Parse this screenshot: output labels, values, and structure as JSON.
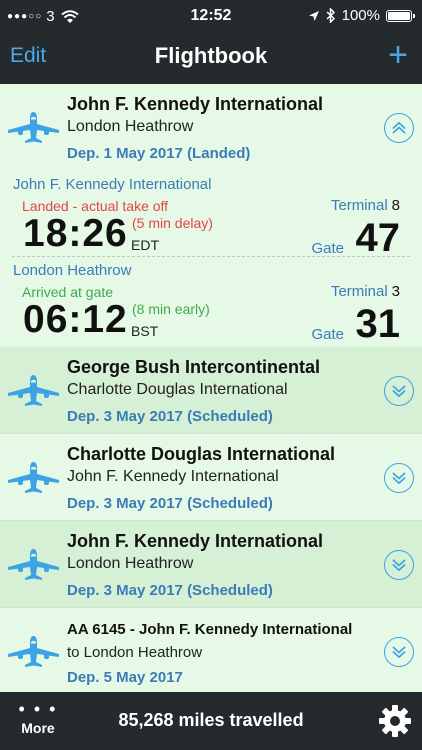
{
  "status_bar": {
    "signal_dots": "●●●○○",
    "carrier": "3",
    "time": "12:52",
    "battery": "100%"
  },
  "nav": {
    "edit_label": "Edit",
    "title": "Flightbook",
    "add_label": "+"
  },
  "expanded_flight": {
    "from": "John F. Kennedy International",
    "to": "London Heathrow",
    "departure": "Dep. 1 May 2017 (Landed)",
    "departure_leg": {
      "airport": "John F. Kennedy International",
      "status": "Landed - actual take off",
      "delay": "(5 min delay)",
      "time": "18:26",
      "timezone": "EDT",
      "terminal_label": "Terminal",
      "terminal": "8",
      "gate_label": "Gate",
      "gate": "47"
    },
    "arrival_leg": {
      "airport": "London Heathrow",
      "status": "Arrived at gate",
      "delay": "(8 min early)",
      "time": "06:12",
      "timezone": "BST",
      "terminal_label": "Terminal",
      "terminal": "3",
      "gate_label": "Gate",
      "gate": "31"
    }
  },
  "flights": [
    {
      "from": "George Bush Intercontinental",
      "to": "Charlotte Douglas International",
      "departure": "Dep. 3 May 2017 (Scheduled)"
    },
    {
      "from": "Charlotte Douglas International",
      "to": "John F. Kennedy International",
      "departure": "Dep. 3 May 2017 (Scheduled)"
    },
    {
      "from": "John F. Kennedy International",
      "to": "London Heathrow",
      "departure": "Dep. 3 May 2017 (Scheduled)"
    },
    {
      "from": "AA 6145 - John F. Kennedy International",
      "to": "to London Heathrow",
      "departure": "Dep. 5 May 2017"
    }
  ],
  "tab_bar": {
    "more_dots": "• • •",
    "more_label": "More",
    "miles": "85,268 miles travelled"
  },
  "colors": {
    "accent": "#3ba3e6",
    "link_text": "#3a7bb8",
    "delay_red": "#e24545",
    "early_green": "#3ea94f",
    "bar_background": "#252a2d"
  },
  "icons": {
    "plane": "airplane-icon",
    "collapse": "chevron-up-double-icon",
    "expand": "chevron-down-double-icon",
    "settings": "gear-icon"
  }
}
